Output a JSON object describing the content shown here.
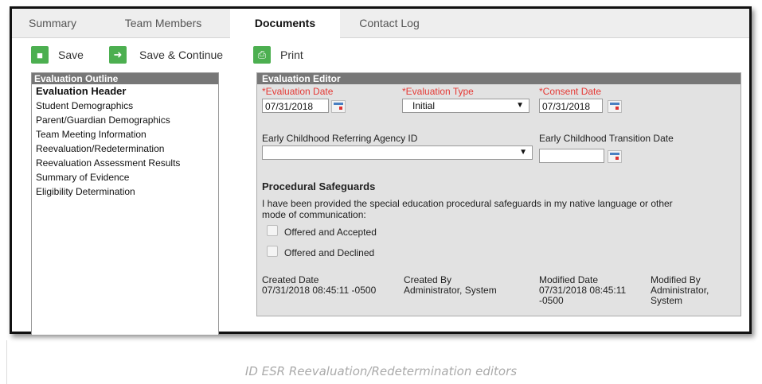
{
  "tabs": [
    {
      "label": "Summary"
    },
    {
      "label": "Team Members"
    },
    {
      "label": "Documents"
    },
    {
      "label": "Contact Log"
    }
  ],
  "toolbar": {
    "save": "Save",
    "save_continue": "Save & Continue",
    "print": "Print"
  },
  "outline": {
    "title": "Evaluation Outline",
    "items": [
      "Evaluation Header",
      "Student Demographics",
      "Parent/Guardian Demographics",
      "Team Meeting Information",
      "Reevaluation/Redetermination",
      "Reevaluation Assessment Results",
      "Summary of Evidence",
      "Eligibility Determination"
    ]
  },
  "editor": {
    "title": "Evaluation Editor",
    "evaluation_date_label": "*Evaluation Date",
    "evaluation_date_value": "07/31/2018",
    "evaluation_type_label": "*Evaluation Type",
    "evaluation_type_value": "Initial",
    "consent_date_label": "*Consent Date",
    "consent_date_value": "07/31/2018",
    "referring_agency_label": "Early Childhood Referring Agency ID",
    "referring_agency_value": "",
    "transition_date_label": "Early Childhood Transition Date",
    "transition_date_value": "",
    "safeguards_heading": "Procedural Safeguards",
    "safeguards_text_1": "I have been provided the special education procedural safeguards in my native language or other",
    "safeguards_text_2": "mode of communication:",
    "option_accepted": "Offered and Accepted",
    "option_declined": "Offered and Declined",
    "created_date_label": "Created Date",
    "created_date_value": "07/31/2018 08:45:11 -0500",
    "created_by_label": "Created By",
    "created_by_value": "Administrator, System",
    "modified_date_label": "Modified Date",
    "modified_date_value_1": "07/31/2018 08:45:11",
    "modified_date_value_2": "-0500",
    "modified_by_label": "Modified By",
    "modified_by_value_1": "Administrator,",
    "modified_by_value_2": "System"
  },
  "caption": "ID ESR Reevaluation/Redetermination editors"
}
